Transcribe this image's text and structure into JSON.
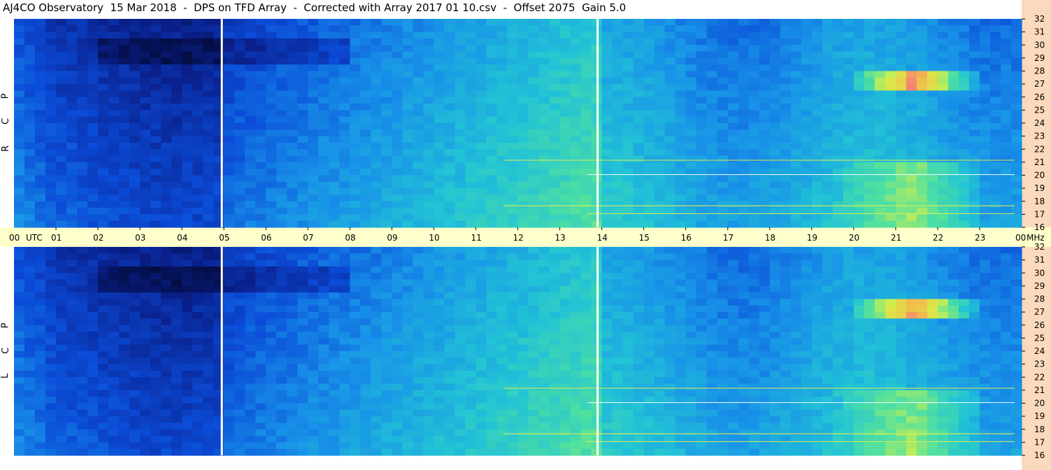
{
  "title": "AJ4CO Observatory  15 Mar 2018  -  DPS on TFD Array  -  Corrected with Array 2017 01 10.csv  -  Offset 2075  Gain 5.0",
  "colors": {
    "axis_bg": "#ffffcc",
    "right_bg": "#fbd9bd",
    "scale": [
      "#020a36",
      "#0a1f8a",
      "#0b4cd8",
      "#1892e8",
      "#22c3d6",
      "#4fe0a0",
      "#d6f04a",
      "#f0c04a",
      "#ff3aa0",
      "#ffffff"
    ]
  },
  "chart_data": [
    {
      "type": "heatmap",
      "name": "RCP panel",
      "polarization_label": [
        "R",
        "C",
        "P"
      ],
      "x_tick_labels": [
        "00",
        "UTC",
        "01",
        "02",
        "03",
        "04",
        "05",
        "06",
        "07",
        "08",
        "09",
        "10",
        "11",
        "12",
        "13",
        "14",
        "15",
        "16",
        "17",
        "18",
        "19",
        "20",
        "21",
        "22",
        "23",
        "00",
        "MHz"
      ],
      "y_tick_labels": [
        "32",
        "31",
        "30",
        "29",
        "28",
        "27",
        "26",
        "25",
        "24",
        "23",
        "22",
        "21",
        "20",
        "19",
        "18",
        "17",
        "16"
      ],
      "xlim": [
        0,
        24
      ],
      "ylim": [
        16,
        32
      ],
      "xlabel": "UTC",
      "ylabel": "MHz",
      "marker_lines_utc": [
        4.95,
        13.9
      ]
    },
    {
      "type": "heatmap",
      "name": "LCP panel",
      "polarization_label": [
        "L",
        "C",
        "P"
      ],
      "y_tick_labels": [
        "32",
        "31",
        "30",
        "29",
        "28",
        "27",
        "26",
        "25",
        "24",
        "23",
        "22",
        "21",
        "20",
        "19",
        "18",
        "17",
        "16"
      ],
      "xlim": [
        0,
        24
      ],
      "ylim": [
        16,
        32
      ],
      "marker_lines_utc": [
        4.95,
        13.9
      ]
    }
  ]
}
